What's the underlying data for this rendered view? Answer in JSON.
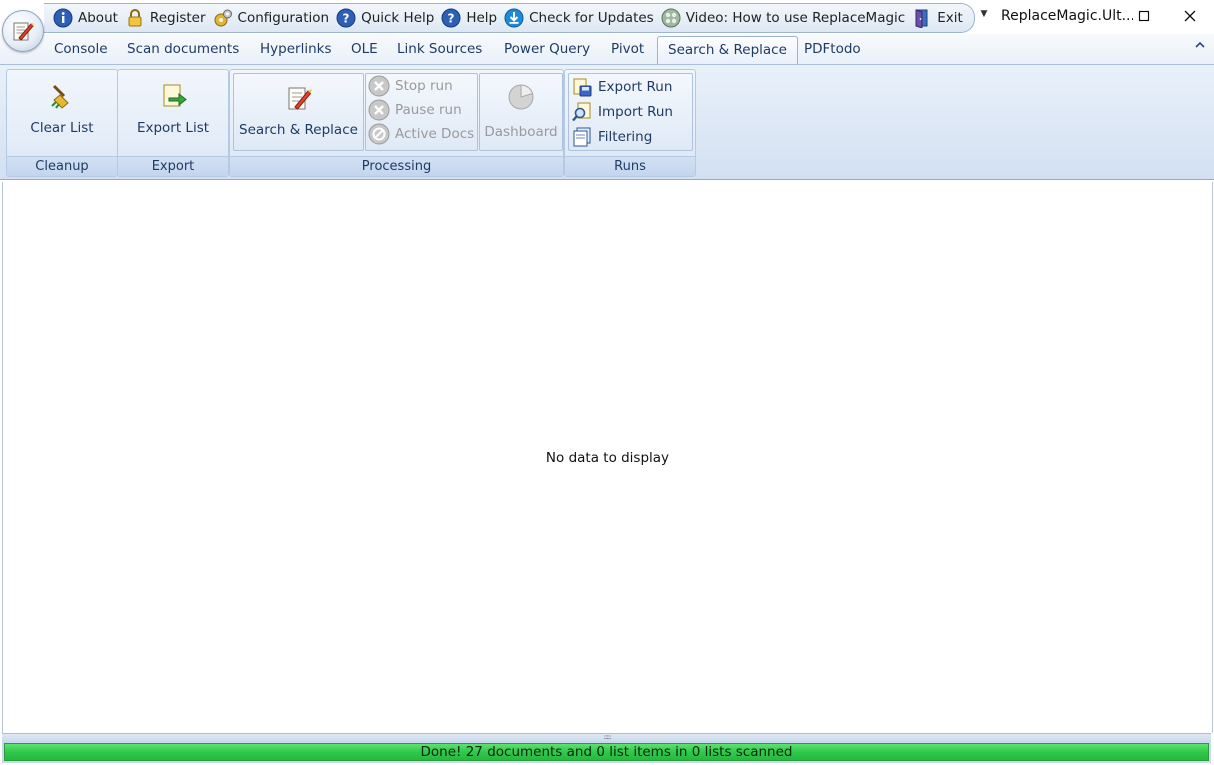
{
  "window": {
    "title": "ReplaceMagic.Ult...",
    "maximize_icon": "maximize-icon",
    "close_icon": "close-icon"
  },
  "quick_access": [
    {
      "label": "About",
      "icon": "info-icon"
    },
    {
      "label": "Register",
      "icon": "padlock-icon"
    },
    {
      "label": "Configuration",
      "icon": "gears-icon"
    },
    {
      "label": "Quick Help",
      "icon": "question-icon"
    },
    {
      "label": "Help",
      "icon": "question-icon"
    },
    {
      "label": "Check for Updates",
      "icon": "download-icon"
    },
    {
      "label": "Video: How to use ReplaceMagic",
      "icon": "film-reel-icon"
    },
    {
      "label": "Exit",
      "icon": "exit-door-icon"
    }
  ],
  "tabs": [
    {
      "label": "Console"
    },
    {
      "label": "Scan documents"
    },
    {
      "label": "Hyperlinks"
    },
    {
      "label": "OLE"
    },
    {
      "label": "Link Sources"
    },
    {
      "label": "Power Query"
    },
    {
      "label": "Pivot"
    },
    {
      "label": "Search & Replace",
      "active": true
    },
    {
      "label": "PDFtodo"
    }
  ],
  "ribbon": {
    "groups": {
      "cleanup": {
        "label": "Cleanup",
        "clear_list": "Clear List"
      },
      "export": {
        "label": "Export",
        "export_list": "Export List"
      },
      "processing": {
        "label": "Processing",
        "search_replace": "Search & Replace",
        "stop_run": "Stop run",
        "pause_run": "Pause run",
        "active_docs": "Active Docs",
        "dashboard": "Dashboard"
      },
      "runs": {
        "label": "Runs",
        "export_run": "Export Run",
        "import_run": "Import Run",
        "filtering": "Filtering"
      }
    }
  },
  "content": {
    "empty_message": "No data to display"
  },
  "status": {
    "message": "Done! 27 documents and 0 list items in 0 lists scanned",
    "progress": 1.0,
    "color": "#2fc94a"
  }
}
